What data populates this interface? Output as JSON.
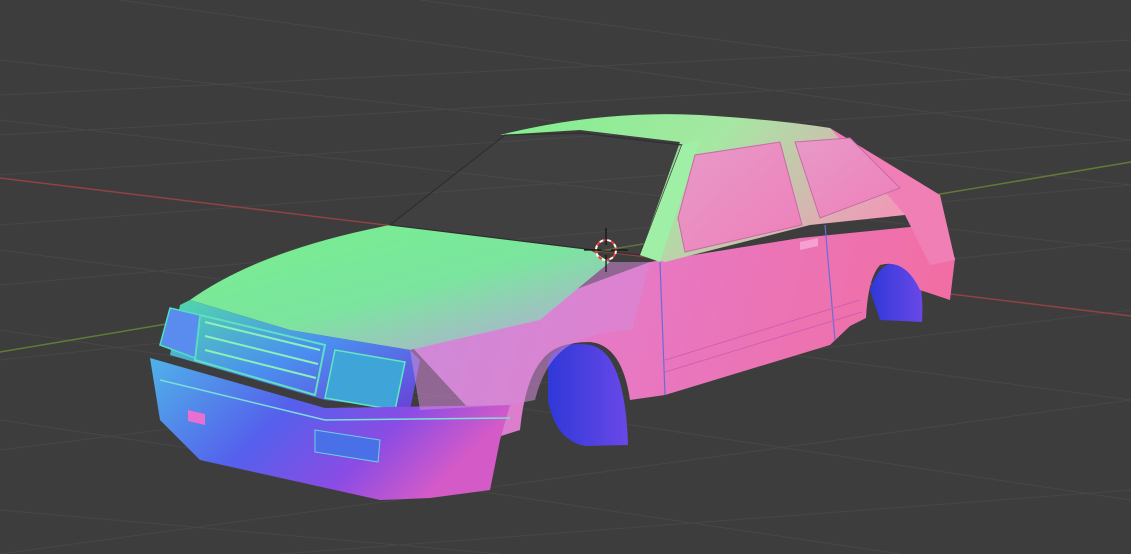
{
  "viewport": {
    "background_color": "#3d3d3d",
    "grid_color": "#4a4a4a",
    "x_axis_color": "#9c4545",
    "y_axis_color": "#6d8a3b"
  },
  "object": {
    "shading": "normal-map",
    "colors": {
      "top": "#7cf092",
      "side": "#e873c8",
      "front": "#5a7cf0",
      "wheel_well": "#3a3ce8"
    }
  },
  "cursor": {
    "icon": "3d-cursor-icon",
    "ring_color_a": "#ff3b3b",
    "ring_color_b": "#ffffff"
  }
}
